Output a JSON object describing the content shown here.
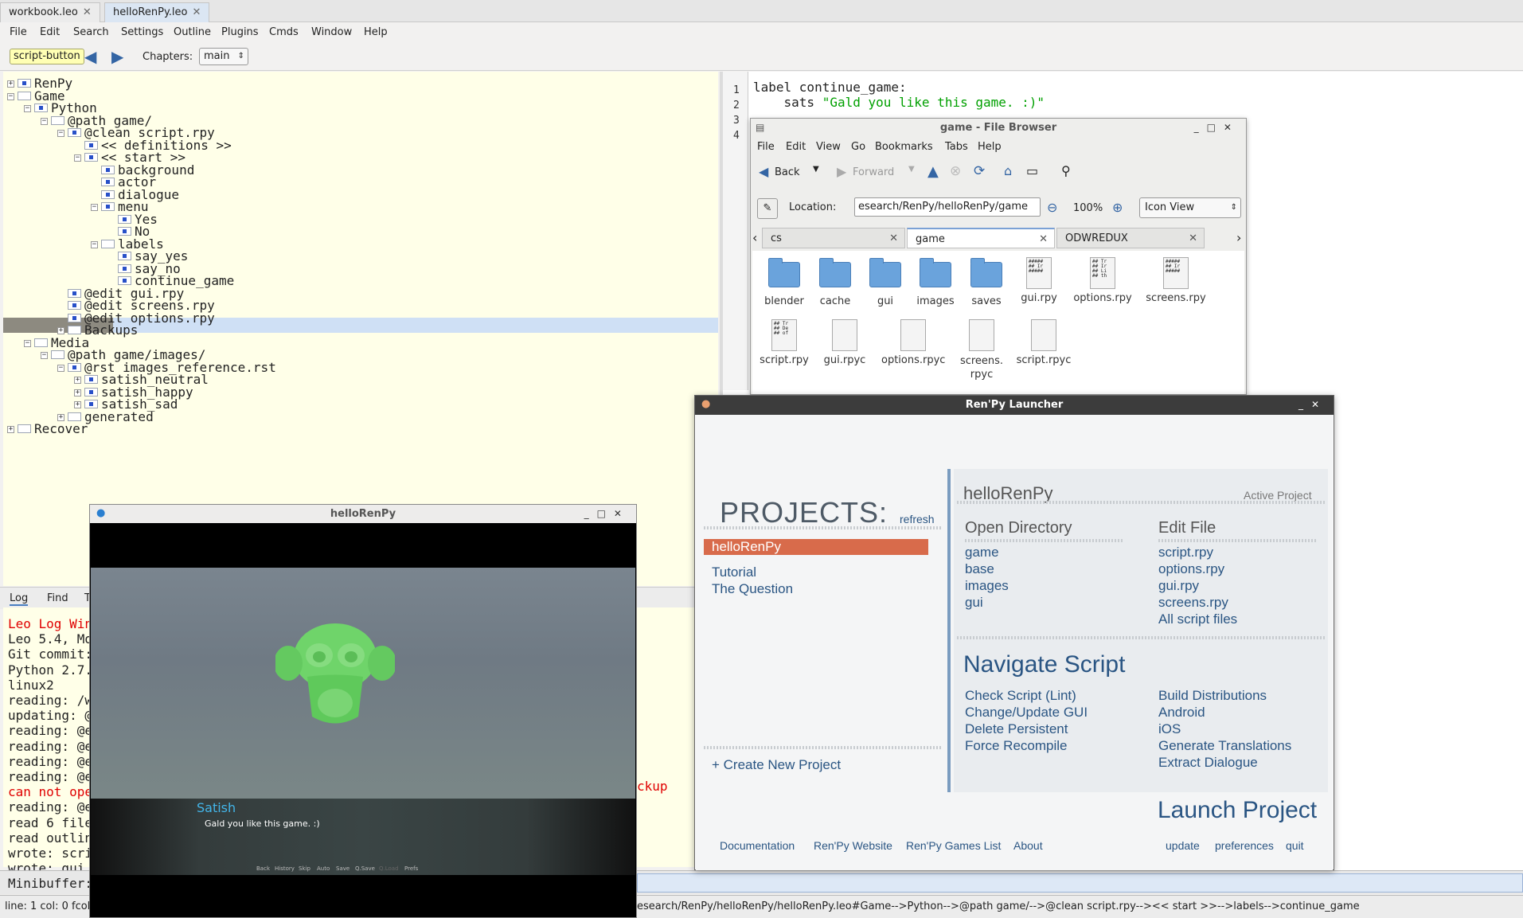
{
  "leo": {
    "tabs": [
      "workbook.leo",
      "helloRenPy.leo"
    ],
    "menu": [
      "File",
      "Edit",
      "Search",
      "Settings",
      "Outline",
      "Plugins",
      "Cmds",
      "Window",
      "Help"
    ],
    "toolbar": {
      "script_button": "script-button",
      "chapters_label": "Chapters:",
      "chapter_value": "main"
    },
    "outline": [
      "RenPy",
      "Game",
      "Python",
      "@path game/",
      "@clean script.rpy",
      "<< definitions >>",
      "<< start >>",
      "background",
      "actor",
      "dialogue",
      "menu",
      "Yes",
      "No",
      "labels",
      "say_yes",
      "say_no",
      "continue_game",
      "@edit gui.rpy",
      "@edit screens.rpy",
      "@edit options.rpy",
      "Backups",
      "Media",
      "@path game/images/",
      "@rst images_reference.rst",
      "satish_neutral",
      "satish_happy",
      "satish_sad",
      "generated",
      "Recover"
    ],
    "body": {
      "line_numbers": [
        "1",
        "2",
        "3",
        "4"
      ],
      "line1": "label continue_game:",
      "line2_kw": "    sats ",
      "line2_str": "\"Gald you like this game. :)\""
    },
    "log_tabs": [
      "Log",
      "Find",
      "T"
    ],
    "log": [
      "Leo Log Wind",
      "Leo 5.4, Mon",
      "Git commit:",
      "Python 2.7.1",
      "linux2",
      "reading: /wo",
      "updating: @c",
      "reading: @ed",
      "reading: @ed",
      "reading: @ed",
      "reading: @ed",
      "can not open",
      "reading: @ed",
      "read 6 files",
      "read outline",
      "wrote: scrip",
      "wrote: gui"
    ],
    "log_tail": "ckup",
    "minibuffer_label": "Minibuffer:",
    "status_left": "line: 1 col: 0 fcol",
    "status_path": "esearch/RenPy/helloRenPy/helloRenPy.leo#Game-->Python-->@path game/-->@clean script.rpy--><< start >>-->labels-->continue_game"
  },
  "file_browser": {
    "title": "game - File Browser",
    "menu": [
      "File",
      "Edit",
      "View",
      "Go",
      "Bookmarks",
      "Tabs",
      "Help"
    ],
    "back": "Back",
    "forward": "Forward",
    "location_label": "Location:",
    "location": "esearch/RenPy/helloRenPy/game",
    "zoom": "100%",
    "view_mode": "Icon View",
    "tabs": [
      "cs",
      "game",
      "ODWREDUX"
    ],
    "folders": [
      "blender",
      "cache",
      "gui",
      "images",
      "saves"
    ],
    "files_row1": [
      "gui.rpy",
      "options.rpy",
      "screens.rpy"
    ],
    "files_row2": [
      "script.rpy",
      "gui.rpyc",
      "options.rpyc",
      "screens.\nrpyc",
      "script.rpyc"
    ]
  },
  "game_window": {
    "title": "helloRenPy",
    "speaker": "Satish",
    "dialogue": "Gald you like this game. :)",
    "quick_menu": [
      "Back",
      "History",
      "Skip",
      "Auto",
      "Save",
      "Q.Save",
      "Q.Load",
      "Prefs"
    ]
  },
  "launcher": {
    "title": "Ren'Py Launcher",
    "projects_heading": "PROJECTS:",
    "refresh": "refresh",
    "projects": [
      "helloRenPy",
      "Tutorial",
      "The Question"
    ],
    "selected_project": "helloRenPy",
    "active_project_label": "Active Project",
    "open_directory": "Open Directory",
    "directories": [
      "game",
      "base",
      "images",
      "gui"
    ],
    "edit_file": "Edit File",
    "edit_files": [
      "script.rpy",
      "options.rpy",
      "gui.rpy",
      "screens.rpy",
      "All script files"
    ],
    "navigate_script": "Navigate Script",
    "nav_left": [
      "Check Script (Lint)",
      "Change/Update GUI",
      "Delete Persistent",
      "Force Recompile"
    ],
    "nav_right": [
      "Build Distributions",
      "Android",
      "iOS",
      "Generate Translations",
      "Extract Dialogue"
    ],
    "create_new": "+ Create New Project",
    "launch": "Launch Project",
    "footer_left": [
      "Documentation",
      "Ren'Py Website",
      "Ren'Py Games List",
      "About"
    ],
    "footer_right": [
      "update",
      "preferences",
      "quit"
    ],
    "selected_color": "#d86b4b"
  }
}
